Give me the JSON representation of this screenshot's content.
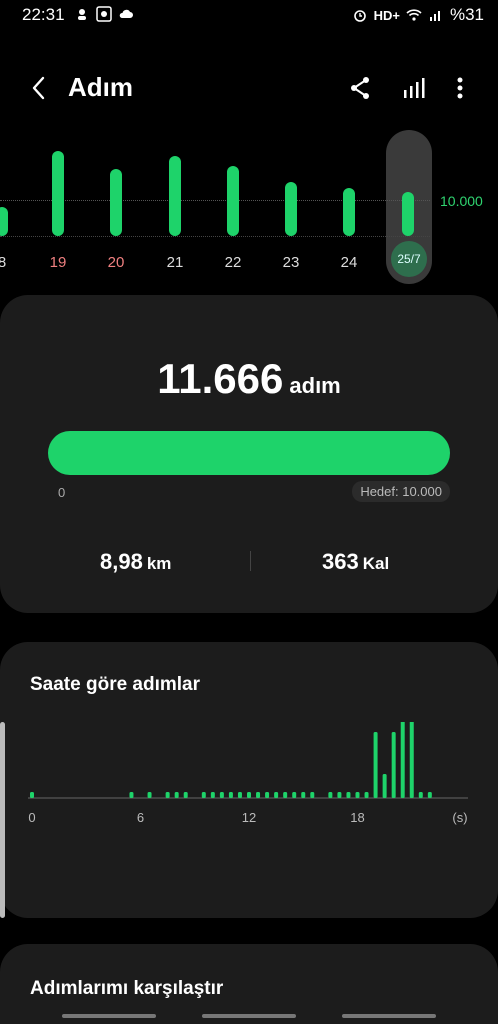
{
  "status_bar": {
    "time": "22:31",
    "right_text_hd": "HD+",
    "battery": "%31",
    "left_icons": [
      "notification-icon",
      "media-icon",
      "cloud-icon"
    ],
    "right_icons": [
      "alarm-icon",
      "wifi-icon",
      "signal-icon"
    ]
  },
  "header": {
    "title": "Adım",
    "icons": [
      "back-icon",
      "share-icon",
      "stats-icon",
      "more-icon"
    ]
  },
  "daily": {
    "goal_label": "10.000",
    "days": [
      {
        "label": "8",
        "weekend": false,
        "steps": 4300
      },
      {
        "label": "19",
        "weekend": true,
        "steps": 12500
      },
      {
        "label": "20",
        "weekend": true,
        "steps": 9800
      },
      {
        "label": "21",
        "weekend": false,
        "steps": 11800
      },
      {
        "label": "22",
        "weekend": false,
        "steps": 10300
      },
      {
        "label": "23",
        "weekend": false,
        "steps": 8000
      },
      {
        "label": "24",
        "weekend": false,
        "steps": 7000
      },
      {
        "label": "25/7",
        "weekend": false,
        "steps": 6500,
        "selected": true
      }
    ],
    "accent_color": "#1ed36a",
    "weekend_color": "#f08080"
  },
  "summary": {
    "steps": "11.666",
    "steps_unit": "adım",
    "progress_min": "0",
    "goal_text": "Hedef: 10.000",
    "progress_fraction": 1.0,
    "distance_value": "8,98",
    "distance_unit": "km",
    "calories_value": "363",
    "calories_unit": "Kal"
  },
  "hourly": {
    "title": "Saate göre adımlar",
    "axis_labels": [
      "0",
      "6",
      "12",
      "18",
      "(s)"
    ],
    "chart_data": {
      "type": "bar",
      "x": [
        0,
        5.5,
        6.5,
        7.5,
        8,
        8.5,
        9.5,
        10,
        10.5,
        11,
        11.5,
        12,
        12.5,
        13,
        13.5,
        14,
        14.5,
        15,
        15.5,
        16.5,
        17,
        17.5,
        18,
        18.5,
        19,
        19.5,
        20,
        20.5,
        21,
        21.5,
        22
      ],
      "values": [
        1,
        1,
        1,
        1,
        1,
        1,
        1,
        1,
        1,
        1,
        1,
        1,
        1,
        1,
        1,
        1,
        1,
        1,
        1,
        1,
        1,
        1,
        1,
        1,
        11,
        4,
        11,
        18,
        13,
        1,
        1
      ],
      "xlim": [
        0,
        24
      ],
      "x_ticks": [
        "0",
        "6",
        "12",
        "18"
      ],
      "x_unit_label": "(s)"
    }
  },
  "compare": {
    "title": "Adımlarımı karşılaştır"
  }
}
